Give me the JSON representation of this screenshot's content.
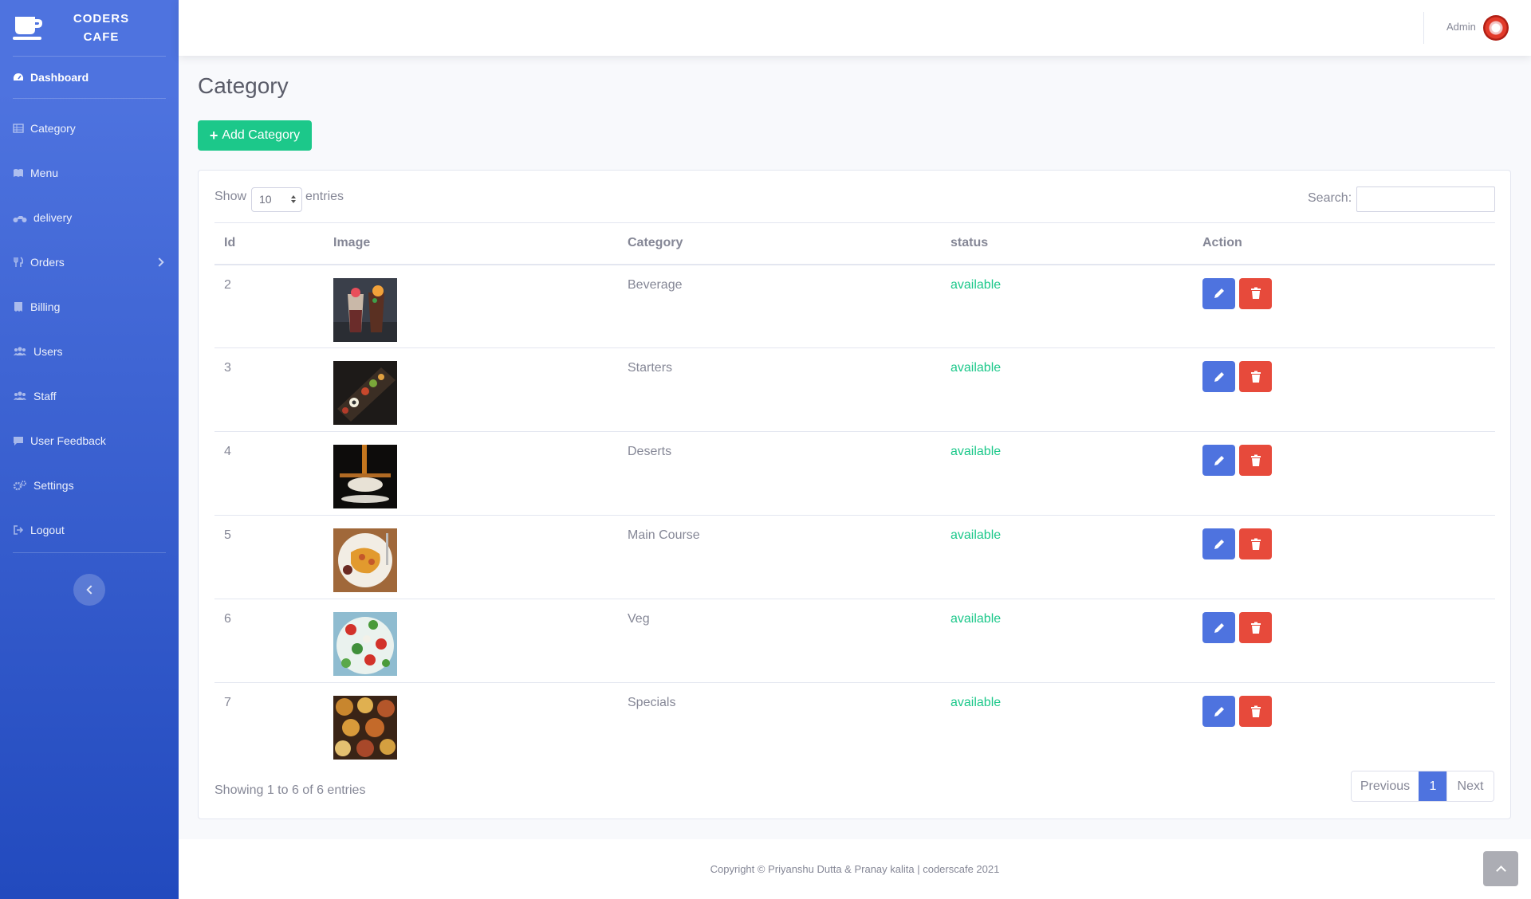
{
  "brand": {
    "line1": "CODERS",
    "line2": "CAFE"
  },
  "sidebar": {
    "dashboard": "Dashboard",
    "items": [
      {
        "label": "Category",
        "icon": "table-icon"
      },
      {
        "label": "Menu",
        "icon": "book-icon"
      },
      {
        "label": "delivery",
        "icon": "motorcycle-icon"
      },
      {
        "label": "Orders",
        "icon": "utensils-icon"
      },
      {
        "label": "Billing",
        "icon": "receipt-icon"
      },
      {
        "label": "Users",
        "icon": "users-icon"
      },
      {
        "label": "Staff",
        "icon": "users-icon"
      },
      {
        "label": "User Feedback",
        "icon": "comment-icon"
      },
      {
        "label": "Settings",
        "icon": "cogs-icon"
      },
      {
        "label": "Logout",
        "icon": "sign-out-icon"
      }
    ]
  },
  "topbar": {
    "user_name": "Admin"
  },
  "page": {
    "title": "Category",
    "add_button": "Add Category"
  },
  "table_controls": {
    "show": "Show",
    "page_size": "10",
    "entries": "entries",
    "search_label": "Search:",
    "search_value": ""
  },
  "table": {
    "headers": [
      "Id",
      "Image",
      "Category",
      "status",
      "Action"
    ],
    "rows": [
      {
        "id": "2",
        "category": "Beverage",
        "status": "available"
      },
      {
        "id": "3",
        "category": "Starters",
        "status": "available"
      },
      {
        "id": "4",
        "category": "Deserts",
        "status": "available"
      },
      {
        "id": "5",
        "category": "Main Course",
        "status": "available"
      },
      {
        "id": "6",
        "category": "Veg",
        "status": "available"
      },
      {
        "id": "7",
        "category": "Specials",
        "status": "available"
      }
    ]
  },
  "pagination": {
    "showing": "Showing 1 to 6 of 6 entries",
    "previous": "Previous",
    "current": "1",
    "next": "Next"
  },
  "footer": {
    "copyright": "Copyright © Priyanshu Dutta & Pranay kalita | coderscafe 2021"
  },
  "colors": {
    "primary": "#4e73df",
    "success": "#1cc88a",
    "danger": "#e74a3b"
  }
}
